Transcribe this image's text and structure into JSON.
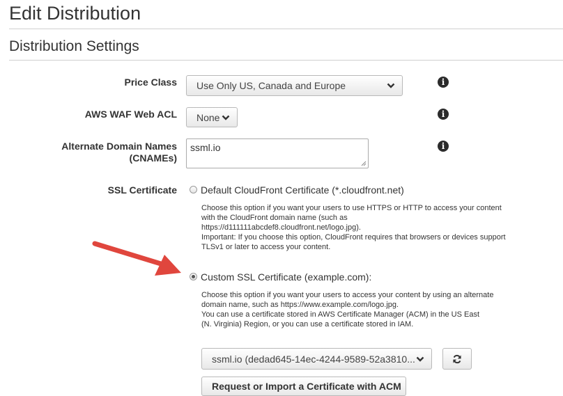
{
  "page": {
    "title": "Edit Distribution"
  },
  "section": {
    "title": "Distribution Settings"
  },
  "price_class": {
    "label": "Price Class",
    "value": "Use Only US, Canada and Europe"
  },
  "waf": {
    "label": "AWS WAF Web ACL",
    "value": "None"
  },
  "cnames": {
    "label_line1": "Alternate Domain Names",
    "label_line2": "(CNAMEs)",
    "value": "ssml.io"
  },
  "ssl": {
    "label": "SSL Certificate",
    "default_option": {
      "label": "Default CloudFront Certificate (*.cloudfront.net)",
      "selected": false,
      "help": [
        "Choose this option if you want your users to use HTTPS or HTTP to access your content",
        "with the CloudFront domain name (such as",
        "https://d111111abcdef8.cloudfront.net/logo.jpg).",
        "Important: If you choose this option, CloudFront requires that browsers or devices support",
        "TLSv1 or later to access your content."
      ]
    },
    "custom_option": {
      "label": "Custom SSL Certificate (example.com):",
      "selected": true,
      "help": [
        "Choose this option if you want your users to access your content by using an alternate",
        "domain name, such as https://www.example.com/logo.jpg.",
        "You can use a certificate stored in AWS Certificate Manager (ACM) in the US East",
        "(N. Virginia) Region, or you can use a certificate stored in IAM."
      ]
    },
    "certificate_select": {
      "value": "ssml.io (dedad645-14ec-4244-9589-52a3810..."
    },
    "request_button_label": "Request or Import a Certificate with ACM"
  },
  "icons": {
    "info": "info-icon",
    "refresh": "refresh-icon",
    "chevron": "chevron-down-icon"
  },
  "colors": {
    "annotation_arrow": "#e0463d"
  }
}
